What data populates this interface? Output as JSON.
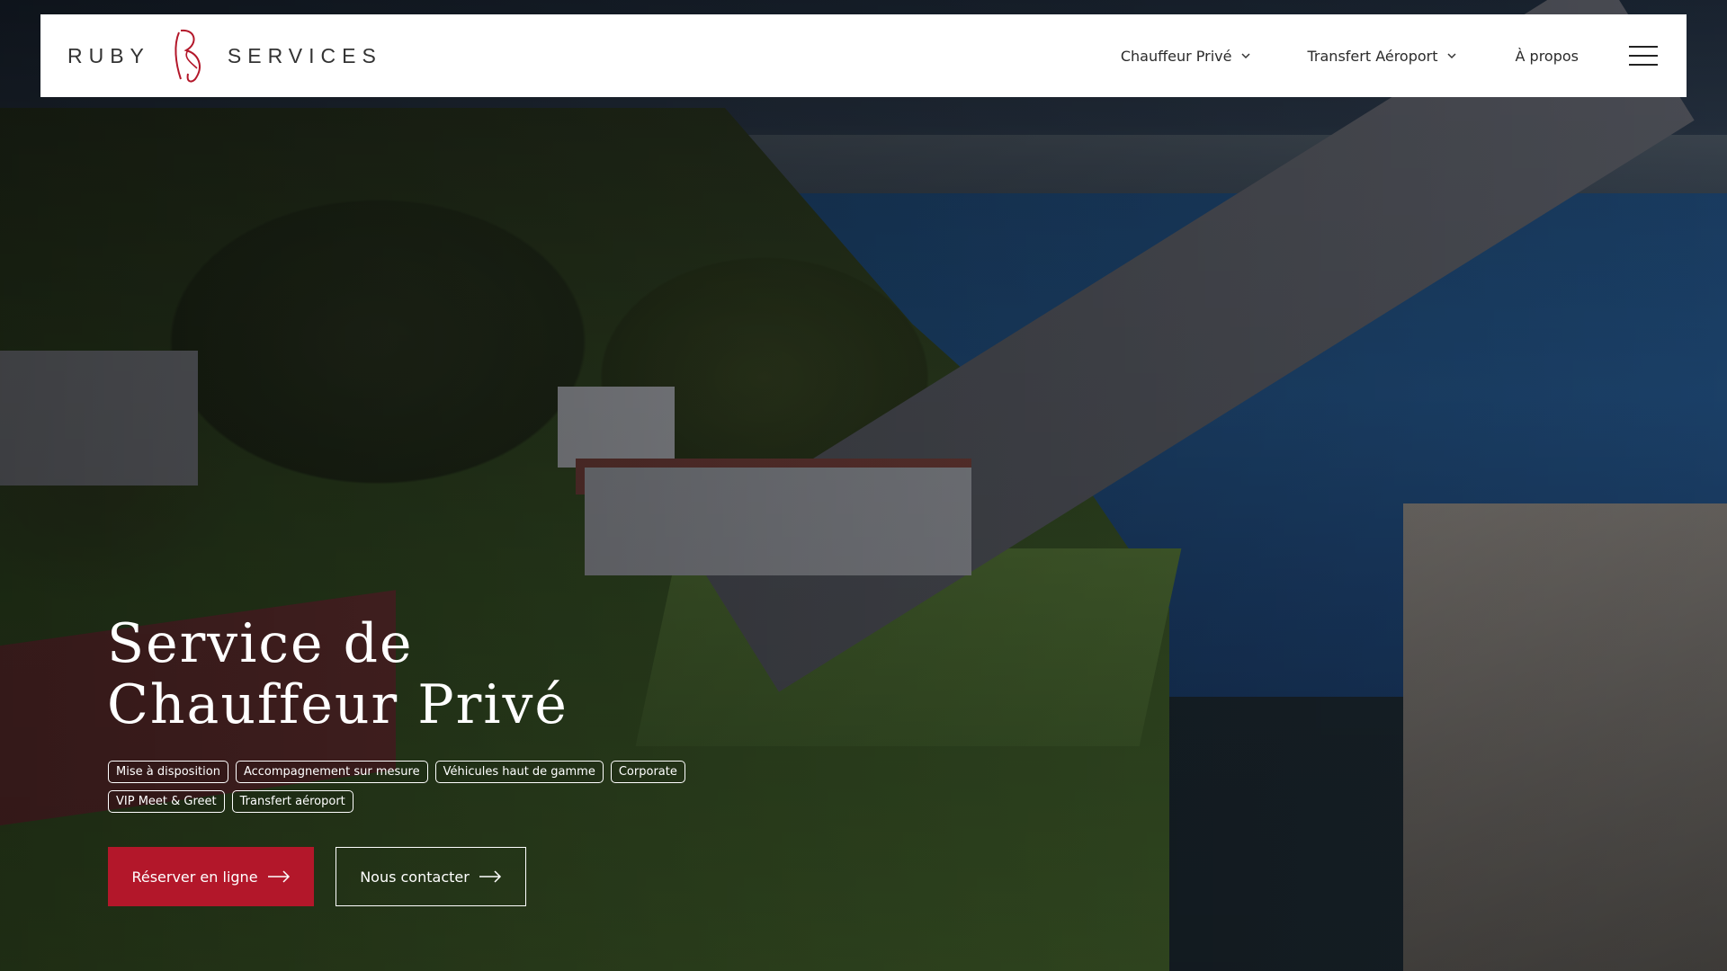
{
  "brand": {
    "left_word": "RUBY",
    "right_word": "SERVICES",
    "accent_color": "#b3172a"
  },
  "nav": {
    "items": [
      {
        "label": "Chauffeur Privé",
        "has_dropdown": true,
        "icon": "chevron-down-icon"
      },
      {
        "label": "Transfert Aéroport",
        "has_dropdown": true,
        "icon": "chevron-down-icon"
      },
      {
        "label": "À propos",
        "has_dropdown": false
      }
    ],
    "menu_icon": "hamburger-menu-icon"
  },
  "hero": {
    "title_line1": "Service de",
    "title_line2": "Chauffeur Privé",
    "tags": [
      "Mise à disposition",
      "Accompagnement sur mesure",
      "Véhicules haut de gamme",
      "Corporate",
      "VIP Meet & Greet",
      "Transfert aéroport"
    ],
    "primary_button": "Réserver en ligne",
    "secondary_button": "Nous contacter",
    "button_icon": "arrow-right-icon"
  }
}
